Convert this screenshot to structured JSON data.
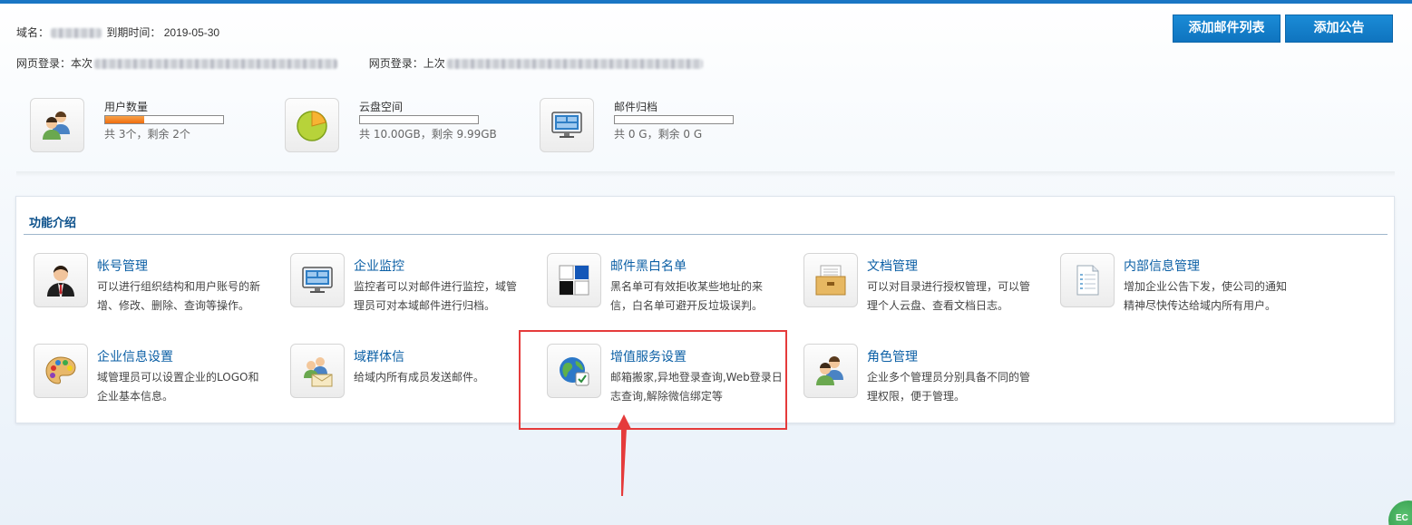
{
  "header": {
    "domain_label": "域名：",
    "expire_label": "到期时间：",
    "expire_date": "2019-05-30",
    "login_this_label": "网页登录：本次",
    "login_last_label": "网页登录：上次"
  },
  "buttons": {
    "add_mail_list": "添加邮件列表",
    "add_notice": "添加公告"
  },
  "stats": [
    {
      "name": "用户数量",
      "desc": "共 3个，剩余 2个",
      "used_fraction": 0.333,
      "icon": "users-icon"
    },
    {
      "name": "云盘空间",
      "desc": "共 10.00GB，剩余 9.99GB",
      "used_fraction": 0.001,
      "icon": "pie-chart-icon"
    },
    {
      "name": "邮件归档",
      "desc": "共 0 G，剩余 0 G",
      "used_fraction": 0,
      "icon": "monitor-icon"
    }
  ],
  "panel": {
    "title": "功能介绍",
    "features": [
      {
        "title": "帐号管理",
        "desc": "可以进行组织结构和用户账号的新增、修改、删除、查询等操作。",
        "icon": "account-user-icon"
      },
      {
        "title": "企业监控",
        "desc": "监控者可以对邮件进行监控，域管理员可对本域邮件进行归档。",
        "icon": "monitor-icon"
      },
      {
        "title": "邮件黑白名单",
        "desc": "黑名单可有效拒收某些地址的来信，白名单可避开反垃圾误判。",
        "icon": "blackwhite-list-icon"
      },
      {
        "title": "文档管理",
        "desc": "可以对目录进行授权管理，可以管理个人云盘、查看文档日志。",
        "icon": "document-box-icon"
      },
      {
        "title": "内部信息管理",
        "desc": "增加企业公告下发，使公司的通知精神尽快传达给域内所有用户。",
        "icon": "notice-document-icon"
      },
      {
        "title": "企业信息设置",
        "desc": "域管理员可以设置企业的LOGO和企业基本信息。",
        "icon": "palette-icon"
      },
      {
        "title": "域群体信",
        "desc": "给域内所有成员发送邮件。",
        "icon": "group-mail-icon"
      },
      {
        "title": "增值服务设置",
        "desc": "邮箱搬家,异地登录查询,Web登录日志查询,解除微信绑定等",
        "icon": "globe-settings-icon"
      },
      {
        "title": "角色管理",
        "desc": "企业多个管理员分别具备不同的管理权限，便于管理。",
        "icon": "roles-icon"
      }
    ]
  },
  "colors": {
    "accent": "#1a76c4",
    "button": "#1283cf",
    "link": "#0b5fa5",
    "highlight": "#e53b3b",
    "progress": "#f07f1f"
  }
}
